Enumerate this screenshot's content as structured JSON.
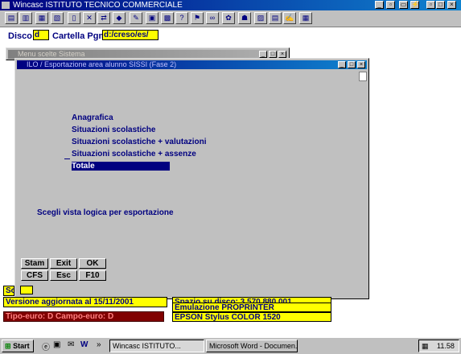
{
  "app": {
    "title": "Wincasc ISTITUTO TECNICO COMMERCIALE"
  },
  "toolbar": {
    "tools": [
      "folder-open-icon",
      "copy-icon",
      "calc-icon",
      "book-icon",
      "printer-icon",
      "tools-icon",
      "shuffle-icon",
      "cube-icon",
      "pencil-icon",
      "layout-icon",
      "question-icon",
      "flag-icon",
      "binoculars-icon",
      "flower-icon",
      "hat-icon",
      "tool-icon",
      "chart-icon",
      "image-icon",
      "edit-icon"
    ],
    "right_tools": [
      "page-icon",
      "folder-icon",
      "plug-icon",
      "help-icon"
    ]
  },
  "disco": {
    "label": "Disco",
    "value": "d",
    "folder_label": "Cartella Pgm",
    "folder_value": "d:/creso/es/"
  },
  "back_window": {
    "title": "Menu scelte Sistema"
  },
  "dialog": {
    "title": "ILO / Esportazione area alunno SISSI (Fase 2)",
    "options": [
      "Anagrafica",
      "Situazioni scolastiche",
      "Situazioni scolastiche + valutazioni",
      "Situazioni scolastiche + assenze",
      "Totale"
    ],
    "selected_index": 4,
    "prompt": "Scegli vista logica per esportazione",
    "buttons": {
      "stam": "Stam",
      "exit": "Exit",
      "ok": "OK",
      "cfs": "CFS",
      "esc": "Esc",
      "f10": "F10"
    }
  },
  "status": {
    "left_label_1": "So",
    "version": "Versione aggiornata al 15/11/2001",
    "tipo": "Tipo-euro: D    Campo-euro: D",
    "disk": "Spazio su disco: 3.570.880.001",
    "emulation": "Emulazione PROPRINTER",
    "printer": "EPSON Stylus COLOR 1520"
  },
  "taskbar": {
    "start": "Start",
    "tasks": [
      "Wincasc ISTITUTO...",
      "Microsoft Word - Documen..."
    ],
    "clock": "11.58"
  },
  "colors": {
    "title_active": "#000080",
    "yellow": "#ffff00",
    "face": "#c0c0c0"
  }
}
